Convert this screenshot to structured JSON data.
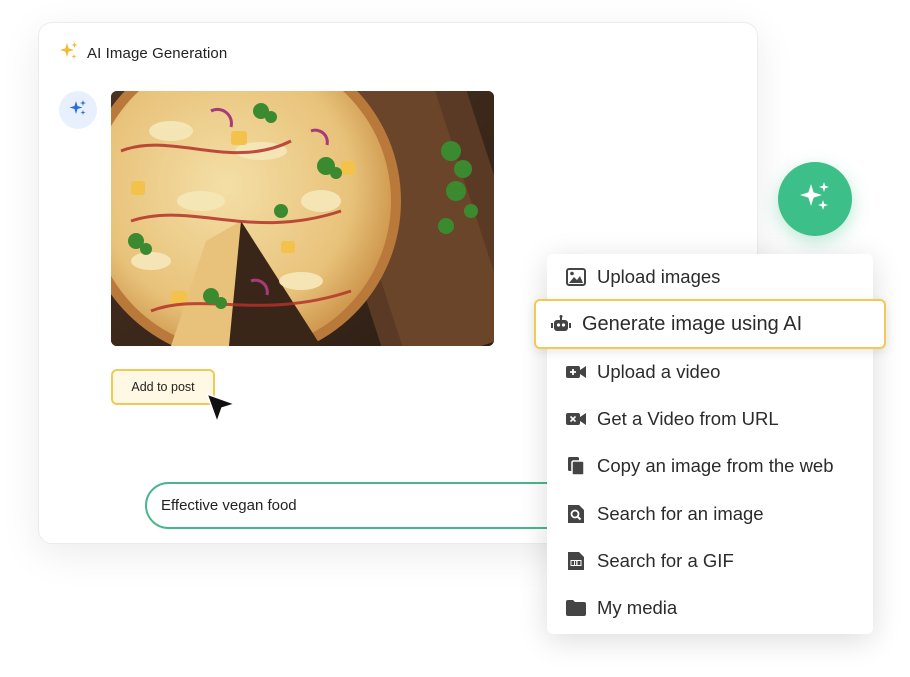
{
  "panel": {
    "title": "AI Image Generation",
    "add_button_label": "Add to post",
    "prompt_input": {
      "value": "Effective vegan food",
      "placeholder": ""
    }
  },
  "menu": {
    "items": [
      {
        "label": "Upload images",
        "icon": "image-icon"
      },
      {
        "label": "Generate image using AI",
        "icon": "robot-icon",
        "highlighted": true
      },
      {
        "label": "Upload a video",
        "icon": "video-camera-icon"
      },
      {
        "label": "Get a Video from URL",
        "icon": "video-link-icon"
      },
      {
        "label": "Copy an image from the web",
        "icon": "copy-icon"
      },
      {
        "label": "Search for an image",
        "icon": "image-search-icon"
      },
      {
        "label": "Search for a GIF",
        "icon": "gif-file-icon"
      },
      {
        "label": "My media",
        "icon": "folder-icon"
      }
    ]
  },
  "colors": {
    "accent_green": "#3dbf8a",
    "highlight_yellow": "#f2c955",
    "sparkle_orange": "#f5b92e",
    "sparkle_blue": "#2b6fd6"
  }
}
